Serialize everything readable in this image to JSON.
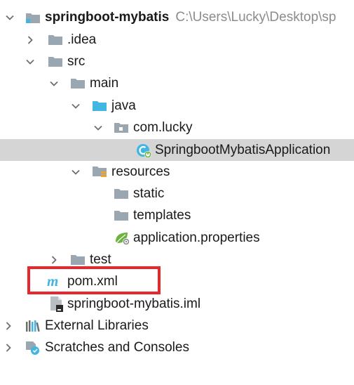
{
  "project": {
    "name": "springboot-mybatis",
    "path": "C:\\Users\\Lucky\\Desktop\\sp"
  },
  "items": {
    "idea": ".idea",
    "src": "src",
    "main": "main",
    "java": "java",
    "package": "com.lucky",
    "app_class": "SpringbootMybatisApplication",
    "resources": "resources",
    "static": "static",
    "templates": "templates",
    "properties": "application.properties",
    "test": "test",
    "pom": "pom.xml",
    "iml": "springboot-mybatis.iml",
    "external_libraries": "External Libraries",
    "scratches": "Scratches and Consoles"
  },
  "colors": {
    "selection": "#d5d5d5",
    "highlight_box": "#e8262b",
    "folder": "#9aa7b0",
    "source_folder": "#40b6e0",
    "path_text": "#8c8c8c"
  }
}
